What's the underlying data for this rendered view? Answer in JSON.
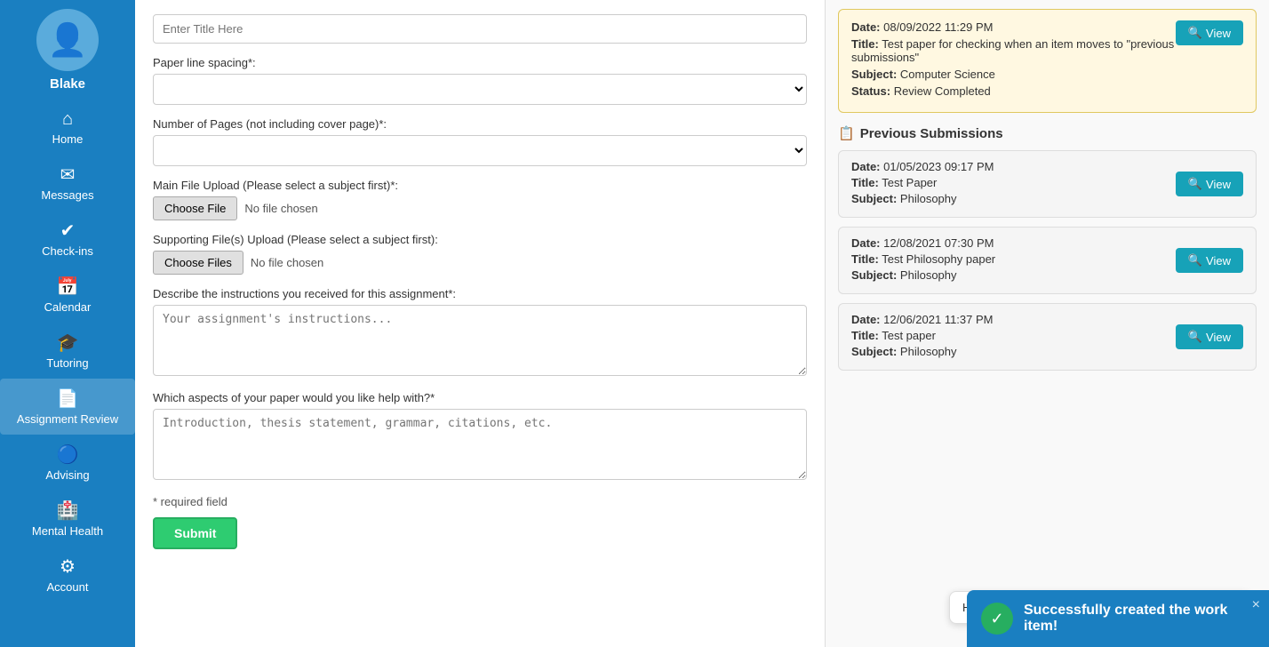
{
  "sidebar": {
    "username": "Blake",
    "items": [
      {
        "label": "Home",
        "icon": "⌂",
        "id": "home"
      },
      {
        "label": "Messages",
        "icon": "✉",
        "id": "messages"
      },
      {
        "label": "Check-ins",
        "icon": "✓",
        "id": "check-ins"
      },
      {
        "label": "Calendar",
        "icon": "📅",
        "id": "calendar"
      },
      {
        "label": "Tutoring",
        "icon": "🎓",
        "id": "tutoring"
      },
      {
        "label": "Assignment Review",
        "icon": "📄",
        "id": "assignment-review",
        "active": true
      },
      {
        "label": "Advising",
        "icon": "🔵",
        "id": "advising"
      },
      {
        "label": "Mental Health",
        "icon": "🏥",
        "id": "mental-health"
      },
      {
        "label": "Account",
        "icon": "⚙",
        "id": "account"
      }
    ]
  },
  "form": {
    "title_placeholder": "Enter Title Here",
    "line_spacing_label": "Paper line spacing*:",
    "pages_label": "Number of Pages (not including cover page)*:",
    "main_file_label": "Main File Upload (Please select a subject first)*:",
    "choose_file_btn": "Choose File",
    "no_file_text": "No file chosen",
    "supporting_files_label": "Supporting File(s) Upload (Please select a subject first):",
    "choose_files_btn": "Choose Files",
    "no_files_text": "No file chosen",
    "instructions_label": "Describe the instructions you received for this assignment*:",
    "instructions_placeholder": "Your assignment's instructions...",
    "aspects_label": "Which aspects of your paper would you like help with?*",
    "aspects_placeholder": "Introduction, thesis statement, grammar, citations, etc.",
    "required_note": "* required field",
    "submit_btn": "Submit"
  },
  "current_submission": {
    "date_label": "Date:",
    "date_value": "08/09/2022 11:29 PM",
    "title_label": "Title:",
    "title_value": "Test paper for checking when an item moves to \"previous submissions\"",
    "subject_label": "Subject:",
    "subject_value": "Computer Science",
    "status_label": "Status:",
    "status_value": "Review Completed",
    "view_btn": "View"
  },
  "previous_submissions": {
    "section_title": "Previous Submissions",
    "items": [
      {
        "date_label": "Date:",
        "date_value": "01/05/2023 09:17 PM",
        "title_label": "Title:",
        "title_value": "Test Paper",
        "subject_label": "Subject:",
        "subject_value": "Philosophy",
        "view_btn": "View"
      },
      {
        "date_label": "Date:",
        "date_value": "12/08/2021 07:30 PM",
        "title_label": "Title:",
        "title_value": "Test Philosophy paper",
        "subject_label": "Subject:",
        "subject_value": "Philosophy",
        "view_btn": "View"
      },
      {
        "date_label": "Date:",
        "date_value": "12/06/2021 11:37 PM",
        "title_label": "Title:",
        "title_value": "Test paper",
        "subject_label": "Subject:",
        "subject_value": "Philosophy",
        "view_btn": "View"
      }
    ]
  },
  "chat": {
    "bubble_text": "Hi. Need any help?",
    "close_label": "×"
  },
  "toast": {
    "message": "Successfully created the work item!",
    "close_label": "×"
  }
}
